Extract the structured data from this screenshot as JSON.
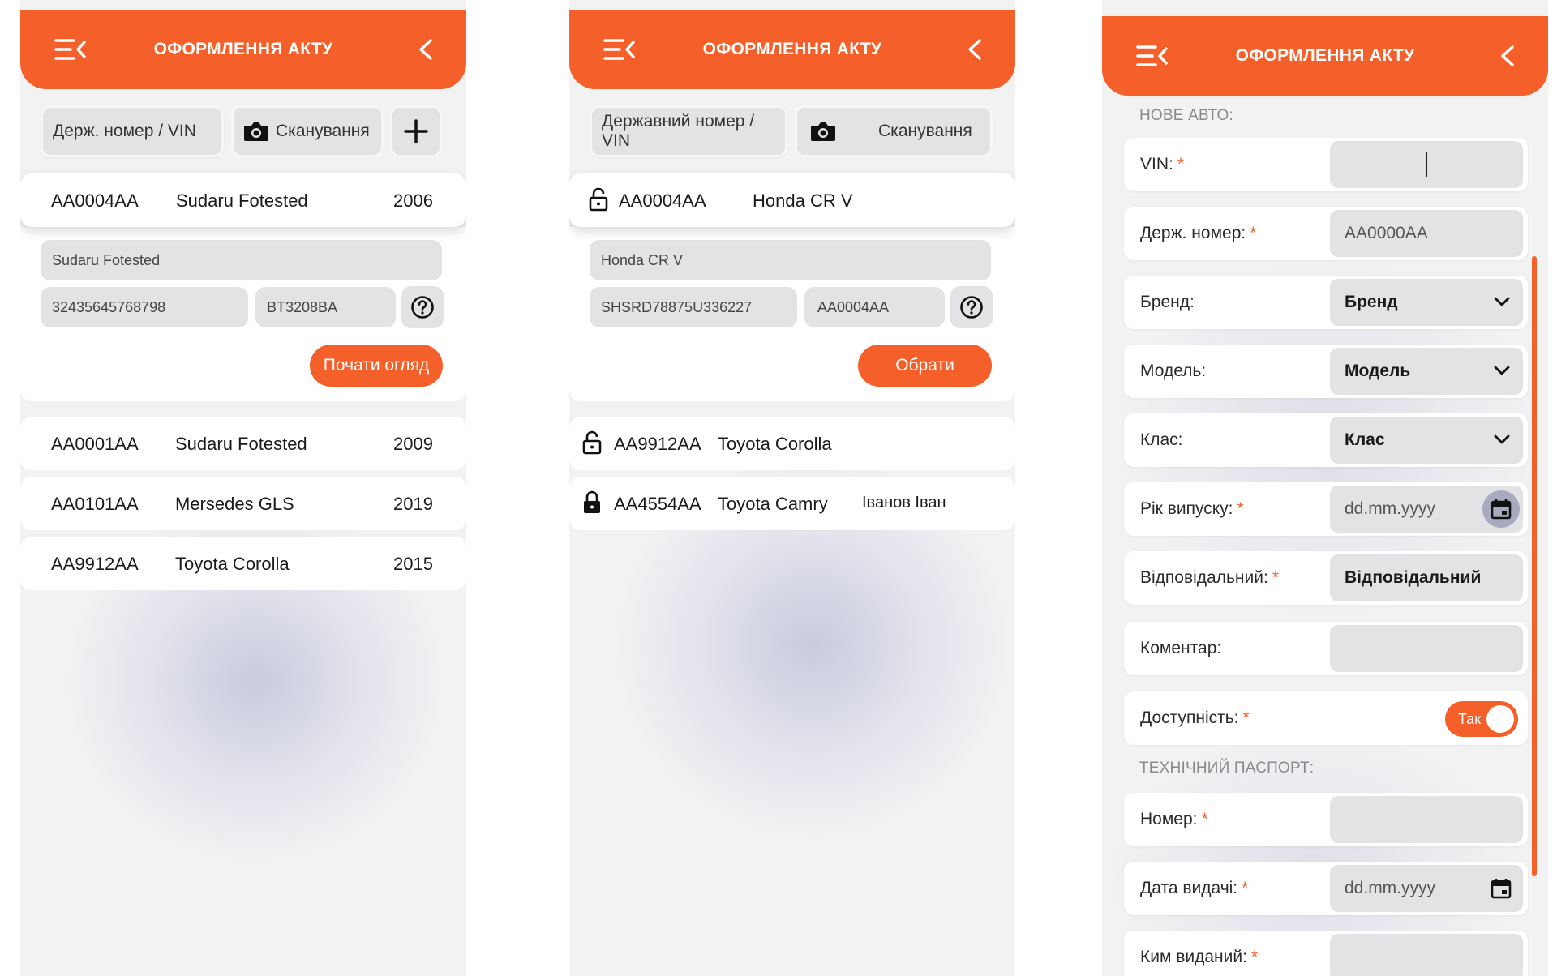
{
  "screens": {
    "list_screen": {
      "header": {
        "title": "ОФОРМЛЕННЯ АКТУ"
      },
      "search": {
        "label": "Держ. номер / VIN"
      },
      "scan": {
        "label": "Сканування"
      },
      "selected": {
        "plate": "AA0004AA",
        "model": "Sudaru Fotested",
        "year": "2006",
        "field_model": "Sudaru Fotested",
        "field_vin": "32435645768798",
        "field_plate": "BT3208BA",
        "action": "Почати огляд"
      },
      "rows": [
        {
          "plate": "AA0001AA",
          "model": "Sudaru Fotested",
          "year": "2009"
        },
        {
          "plate": "AA0101AA",
          "model": "Mersedes GLS",
          "year": "2019"
        },
        {
          "plate": "AA9912AA",
          "model": "Toyota Corolla",
          "year": "2015"
        }
      ]
    },
    "select_screen": {
      "header": {
        "title": "ОФОРМЛЕННЯ АКТУ"
      },
      "search": {
        "label": "Державний номер / VIN"
      },
      "scan": {
        "label": "Сканування"
      },
      "selected": {
        "plate": "AA0004AA",
        "model": "Honda CR V",
        "field_model": "Honda CR V",
        "field_vin": "SHSRD78875U336227",
        "field_plate": "AA0004AA",
        "action": "Обрати"
      },
      "rows": [
        {
          "plate": "AA9912AA",
          "model": "Toyota Corolla",
          "owner": "",
          "locked": false
        },
        {
          "plate": "AA4554AA",
          "model": "Toyota Camry",
          "owner": "Іванов Іван",
          "locked": true
        }
      ]
    },
    "form_screen": {
      "header": {
        "title": "ОФОРМЛЕННЯ АКТУ"
      },
      "section_new_car": "НОВЕ АВТО:",
      "section_tech_passport": "ТЕХНІЧНИЙ ПАСПОРТ:",
      "fields": {
        "vin": {
          "label": "VIN:",
          "required": "*",
          "value": ""
        },
        "plate": {
          "label": "Держ. номер:",
          "required": "*",
          "placeholder": "AA0000AA"
        },
        "brand": {
          "label": "Бренд:",
          "value": "Бренд"
        },
        "model": {
          "label": "Модель:",
          "value": "Модель"
        },
        "class": {
          "label": "Клас:",
          "value": "Клас"
        },
        "year": {
          "label": "Рік випуску:",
          "required": "*",
          "placeholder": "dd.mm.yyyy"
        },
        "responsible": {
          "label": "Відповідальний:",
          "required": "*",
          "value": "Відповідальний"
        },
        "comment": {
          "label": "Коментар:",
          "value": ""
        },
        "availability": {
          "label": "Доступність:",
          "required": "*",
          "toggle": "Так"
        },
        "passport_number": {
          "label": "Номер:",
          "required": "*",
          "value": ""
        },
        "issue_date": {
          "label": "Дата видачі:",
          "required": "*",
          "placeholder": "dd.mm.yyyy"
        },
        "issued_by": {
          "label": "Ким виданий:",
          "required": "*",
          "value": ""
        }
      }
    }
  },
  "colors": {
    "accent": "#f45f2a",
    "panel_bg": "#f2f2f3",
    "field_bg": "#e3e3e5"
  }
}
